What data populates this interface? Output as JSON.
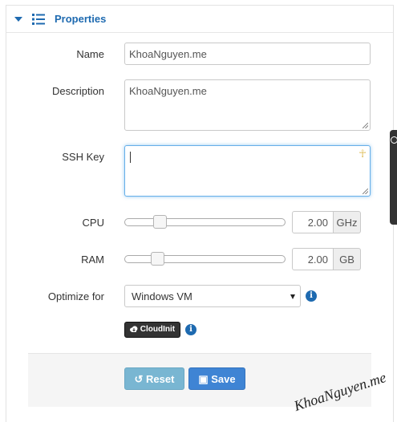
{
  "panel": {
    "title": "Properties"
  },
  "fields": {
    "name": {
      "label": "Name",
      "value": "KhoaNguyen.me"
    },
    "description": {
      "label": "Description",
      "value": "KhoaNguyen.me"
    },
    "ssh_key": {
      "label": "SSH Key",
      "value": ""
    },
    "cpu": {
      "label": "CPU",
      "value": "2.00",
      "unit": "GHz",
      "slider_level": 0.2
    },
    "ram": {
      "label": "RAM",
      "value": "2.00",
      "unit": "GB",
      "slider_level": 0.18
    },
    "optimize_for": {
      "label": "Optimize for",
      "selected": "Windows VM"
    }
  },
  "badges": {
    "cloudinit": "CloudInit"
  },
  "buttons": {
    "reset": "Reset",
    "save": "Save"
  },
  "watermark": "KhoaNguyen.me",
  "colors": {
    "accent": "#1e6ab0",
    "save": "#3f84d4",
    "reset": "#79b6d2",
    "focus": "#66afe9"
  }
}
